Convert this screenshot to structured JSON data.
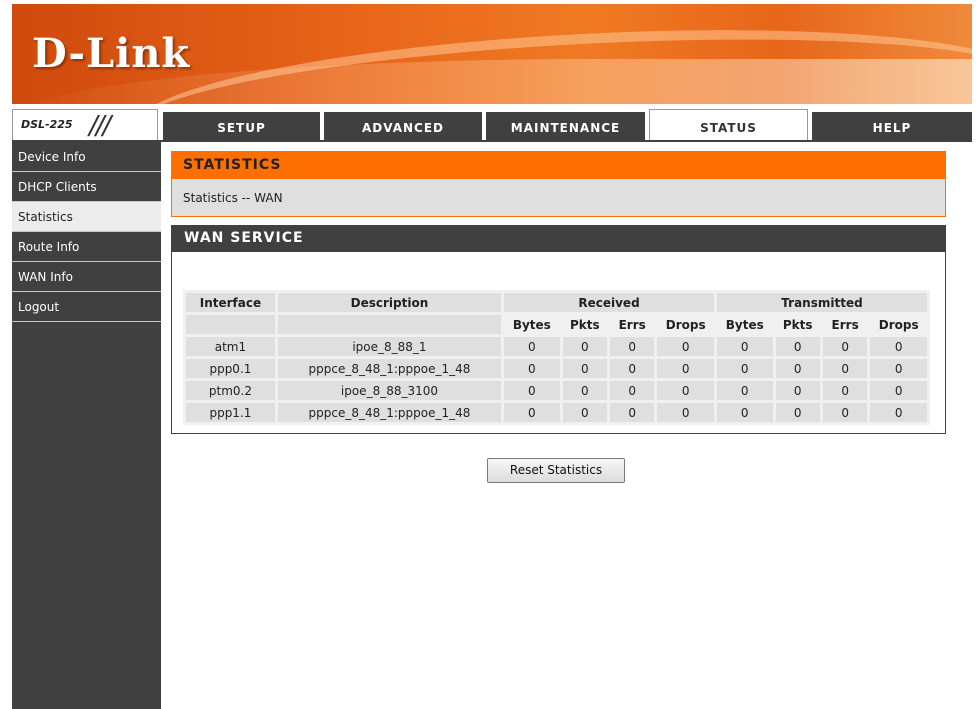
{
  "brand": {
    "logo_text": "D-Link",
    "model": "DSL-225",
    "model_mark": "///"
  },
  "tabs": [
    {
      "label": "SETUP",
      "active": false
    },
    {
      "label": "ADVANCED",
      "active": false
    },
    {
      "label": "MAINTENANCE",
      "active": false
    },
    {
      "label": "STATUS",
      "active": true
    },
    {
      "label": "HELP",
      "active": false
    }
  ],
  "sidebar": {
    "items": [
      {
        "label": "Device Info",
        "active": false
      },
      {
        "label": "DHCP Clients",
        "active": false
      },
      {
        "label": "Statistics",
        "active": true
      },
      {
        "label": "Route Info",
        "active": false
      },
      {
        "label": "WAN Info",
        "active": false
      },
      {
        "label": "Logout",
        "active": false
      }
    ]
  },
  "statistics": {
    "title": "STATISTICS",
    "subtitle": "Statistics -- WAN"
  },
  "wan_service": {
    "title": "WAN SERVICE",
    "headers": {
      "interface": "Interface",
      "description": "Description",
      "received": "Received",
      "transmitted": "Transmitted",
      "sub": [
        "Bytes",
        "Pkts",
        "Errs",
        "Drops",
        "Bytes",
        "Pkts",
        "Errs",
        "Drops"
      ]
    },
    "rows": [
      {
        "interface": "atm1",
        "description": "ipoe_8_88_1",
        "values": [
          "0",
          "0",
          "0",
          "0",
          "0",
          "0",
          "0",
          "0"
        ]
      },
      {
        "interface": "ppp0.1",
        "description": "pppce_8_48_1:pppoe_1_48",
        "values": [
          "0",
          "0",
          "0",
          "0",
          "0",
          "0",
          "0",
          "0"
        ]
      },
      {
        "interface": "ptm0.2",
        "description": "ipoe_8_88_3100",
        "values": [
          "0",
          "0",
          "0",
          "0",
          "0",
          "0",
          "0",
          "0"
        ]
      },
      {
        "interface": "ppp1.1",
        "description": "pppce_8_48_1:pppoe_1_48",
        "values": [
          "0",
          "0",
          "0",
          "0",
          "0",
          "0",
          "0",
          "0"
        ]
      }
    ]
  },
  "reset_button": {
    "label": "Reset Statistics"
  },
  "colors": {
    "accent_orange": "#ff6f00",
    "dark_gray": "#404040",
    "cell_gray": "#dfdfdf"
  }
}
